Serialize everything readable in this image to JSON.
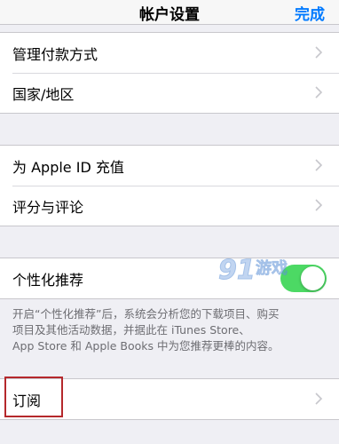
{
  "navbar": {
    "title": "帐户设置",
    "done_label": "完成"
  },
  "group1": {
    "items": [
      {
        "label": "管理付款方式"
      },
      {
        "label": "国家/地区"
      }
    ]
  },
  "group2": {
    "items": [
      {
        "label": "为 Apple ID 充值"
      },
      {
        "label": "评分与评论"
      }
    ]
  },
  "group3": {
    "personalized_label": "个性化推荐",
    "personalized_enabled": true
  },
  "footnote": {
    "line1": "开启“个性化推荐”后，系统会分析您的下载项目、购买",
    "line2": "项目及其他活动数据，并据此在 iTunes Store、",
    "line3": "App Store 和 Apple Books 中为您推荐更棒的内容。"
  },
  "group4": {
    "subscriptions_label": "订阅"
  },
  "watermark": {
    "number": "91",
    "text": "游戏"
  },
  "colors": {
    "accent": "#007aff",
    "toggle_on": "#4cd964",
    "highlight": "#b5282c",
    "background": "#efeff4"
  },
  "icons": {
    "row_disclosure": "chevron-right-icon"
  }
}
